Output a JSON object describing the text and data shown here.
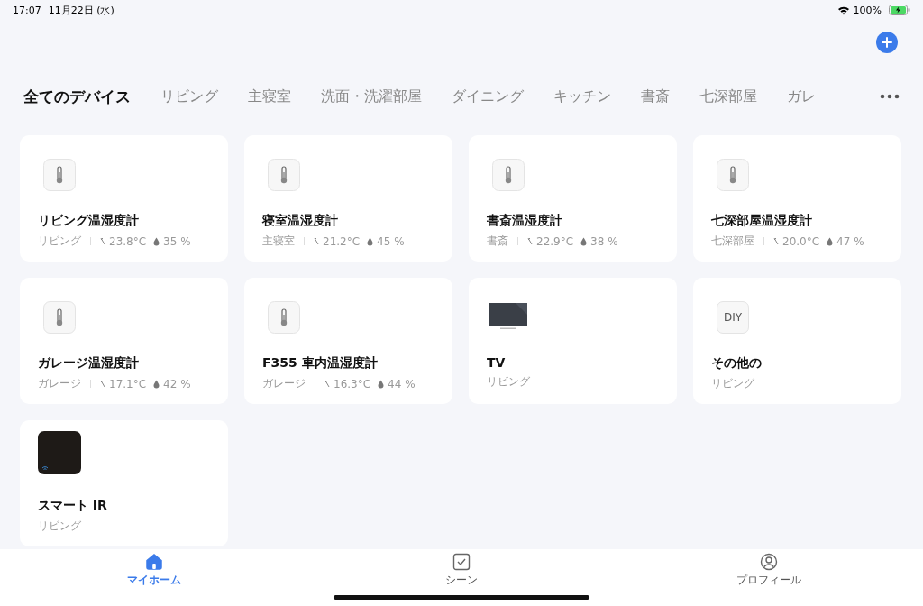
{
  "status_bar": {
    "time": "17:07",
    "date": "11月22日 (水)",
    "battery": "100%"
  },
  "tabs": [
    {
      "label": "全てのデバイス",
      "selected": true
    },
    {
      "label": "リビング",
      "selected": false
    },
    {
      "label": "主寝室",
      "selected": false
    },
    {
      "label": "洗面・洗濯部屋",
      "selected": false
    },
    {
      "label": "ダイニング",
      "selected": false
    },
    {
      "label": "キッチン",
      "selected": false
    },
    {
      "label": "書斎",
      "selected": false
    },
    {
      "label": "七深部屋",
      "selected": false
    },
    {
      "label": "ガレ",
      "selected": false
    }
  ],
  "devices": [
    {
      "kind": "thermo",
      "name": "リビング温湿度計",
      "room": "リビング",
      "temperature": "23.8°C",
      "humidity": "35 %"
    },
    {
      "kind": "thermo",
      "name": "寝室温湿度計",
      "room": "主寝室",
      "temperature": "21.2°C",
      "humidity": "45 %"
    },
    {
      "kind": "thermo",
      "name": "書斎温湿度計",
      "room": "書斎",
      "temperature": "22.9°C",
      "humidity": "38 %"
    },
    {
      "kind": "thermo",
      "name": "七深部屋温湿度計",
      "room": "七深部屋",
      "temperature": "20.0°C",
      "humidity": "47 %"
    },
    {
      "kind": "thermo",
      "name": "ガレージ温湿度計",
      "room": "ガレージ",
      "temperature": "17.1°C",
      "humidity": "42 %"
    },
    {
      "kind": "thermo",
      "name": "F355 車内温湿度計",
      "room": "ガレージ",
      "temperature": "16.3°C",
      "humidity": "44 %"
    },
    {
      "kind": "tv",
      "name": "TV",
      "room": "リビング"
    },
    {
      "kind": "diy",
      "name": "その他の",
      "room": "リビング",
      "icon_text": "DIY"
    },
    {
      "kind": "ir",
      "name": "スマート IR",
      "room": "リビング"
    }
  ],
  "bottom_tabs": [
    {
      "kind": "home",
      "label": "マイホーム",
      "selected": true
    },
    {
      "kind": "scene",
      "label": "シーン",
      "selected": false
    },
    {
      "kind": "profile",
      "label": "プロフィール",
      "selected": false
    }
  ]
}
